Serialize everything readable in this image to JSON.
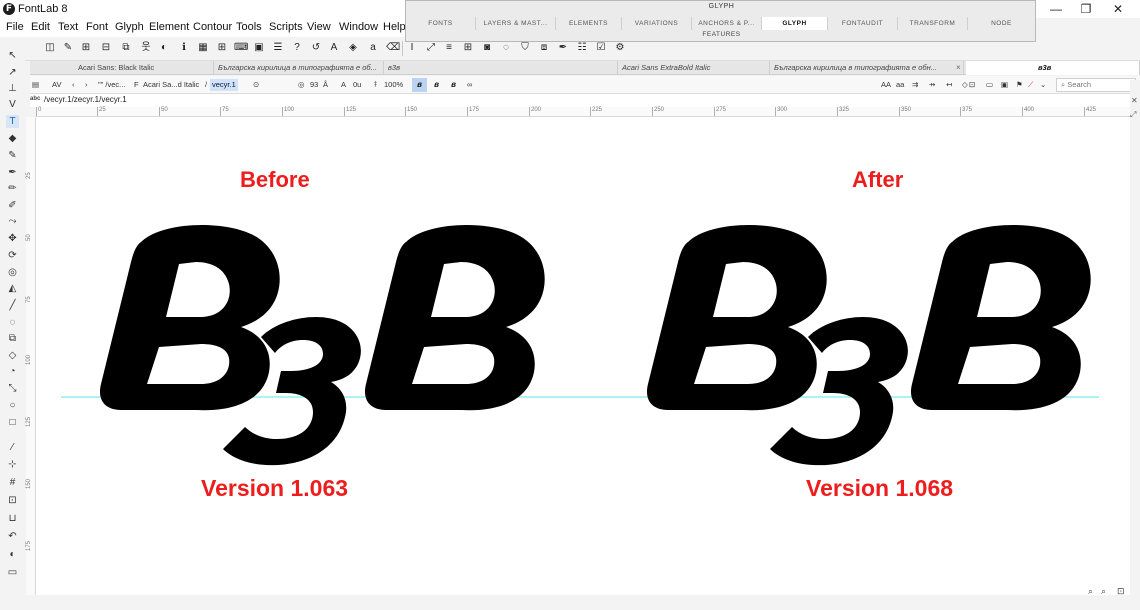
{
  "window": {
    "title": "FontLab 8",
    "logo": "F",
    "controls": [
      "—",
      "❐",
      "✕"
    ]
  },
  "menu": [
    "File",
    "Edit",
    "Text",
    "Font",
    "Glyph",
    "Element",
    "Contour",
    "Tools",
    "Scripts",
    "View",
    "Window",
    "Help"
  ],
  "panel": {
    "title": "GLYPH",
    "tabs": [
      "FONTS",
      "LAYERS & MAST...",
      "ELEMENTS",
      "VARIATIONS",
      "ANCHORS & P...",
      "GLYPH",
      "FONTAUDIT",
      "TRANSFORM",
      "NODE"
    ],
    "active_tab": "GLYPH",
    "sub_tab": "FEATURES"
  },
  "doc_tabs": [
    {
      "label": "Acari Sans: Black Italic",
      "style": "normal"
    },
    {
      "label": "Българска кирилица в типографията е об...",
      "style": "italic"
    },
    {
      "label": "в3в",
      "style": "italic"
    },
    {
      "label": "Acari Sans ExtraBold Italic",
      "style": "italic"
    },
    {
      "label": "Българска кирилица в типографията е обн...",
      "style": "italic"
    },
    {
      "label": "в3в",
      "style": "active"
    }
  ],
  "tab_close": "×",
  "propbar": {
    "nav_text": "\"\" /vec...",
    "font_name": "Acari Sa...d Italic",
    "glyph_name": "vecyr.1",
    "size_value": "93",
    "offset_value": "0u",
    "zoom_value": "100%",
    "buttons": [
      "в",
      "в",
      "в"
    ],
    "search_placeholder": "Search",
    "right_labels": [
      "AA",
      "aa"
    ]
  },
  "path": {
    "icon": "abc",
    "text": "/vecyr.1/zecyr.1/vecyr.1"
  },
  "ruler": {
    "h_ticks": [
      "0",
      "25",
      "50",
      "75",
      "100",
      "125",
      "150",
      "175",
      "200",
      "225",
      "250",
      "275",
      "300",
      "325",
      "350",
      "375",
      "400",
      "425"
    ],
    "v_ticks": [
      "25",
      "50",
      "75",
      "100",
      "125",
      "150",
      "175"
    ]
  },
  "canvas": {
    "before_label": "Before",
    "after_label": "After",
    "before_version": "Version 1.063",
    "after_version": "Version 1.068",
    "label_color": "#ee1d1d",
    "baseline_color": "#7fe9e9",
    "glyph_color": "#000000"
  }
}
